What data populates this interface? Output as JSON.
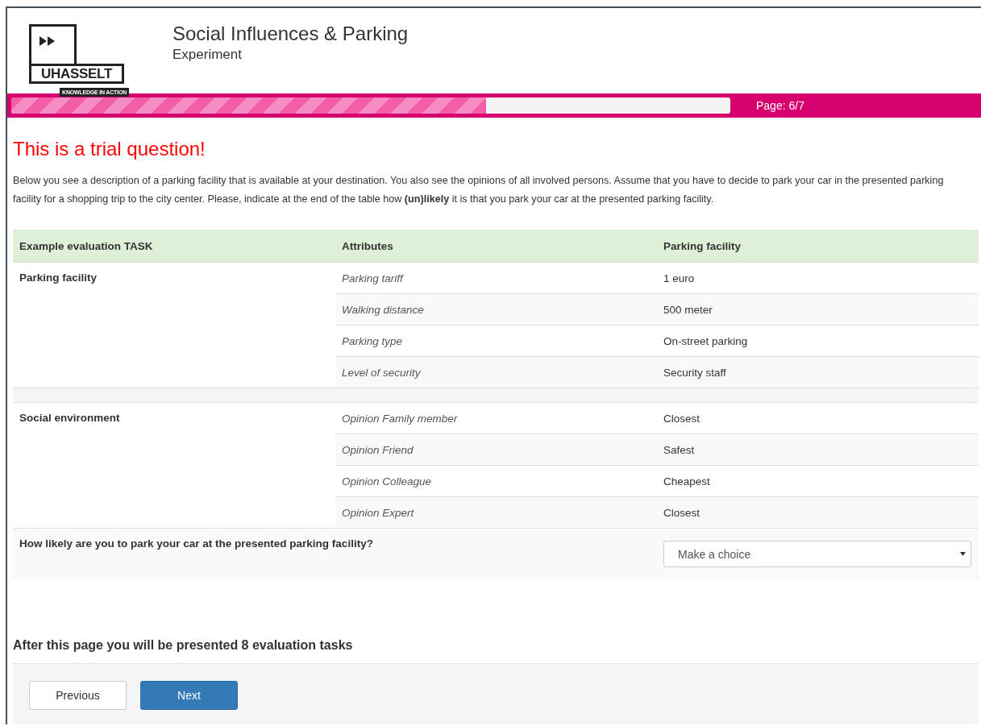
{
  "header": {
    "logo": {
      "name": "UHASSELT",
      "tagline": "KNOWLEDGE IN ACTION"
    },
    "title": "Social Influences & Parking",
    "subtitle": "Experiment"
  },
  "progress": {
    "level": 0.66,
    "label": "Page: 6/7"
  },
  "heading": "This is a trial question!",
  "intro": "Below you see a description of a parking facility that is available at your destination. You also see the opinions of all involved persons. Assume that you have to decide to park your car in the presented parking facility for a shopping trip to the city center. Please, indicate at the end of the table how **(un)likely** it is that you park your car at the presented parking facility.",
  "table": {
    "columns": [
      "Example evaluation TASK",
      "Attributes",
      "Parking facility"
    ],
    "groups": [
      {
        "label": "Parking facility",
        "rows": [
          {
            "attribute": "Parking tariff",
            "value": "1 euro"
          },
          {
            "attribute": "Walking distance",
            "value": "500 meter"
          },
          {
            "attribute": "Parking type",
            "value": "On-street parking"
          },
          {
            "attribute": "Level of security",
            "value": "Security staff"
          }
        ]
      },
      {
        "label": "Social environment",
        "rows": [
          {
            "attribute": "Opinion Family member",
            "value": "Closest"
          },
          {
            "attribute": "Opinion Friend",
            "value": "Safest"
          },
          {
            "attribute": "Opinion Colleague",
            "value": "Cheapest"
          },
          {
            "attribute": "Opinion Expert",
            "value": "Closest"
          }
        ]
      }
    ],
    "question": {
      "label": "How likely are you to park your car at the presented parking facility?",
      "select": {
        "placeholder": "Make a choice"
      }
    }
  },
  "note": "After this page you will be presented 8 evaluation tasks",
  "buttons": [
    {
      "label": "Previous",
      "kind": "default"
    },
    {
      "label": "Next",
      "kind": "primary"
    }
  ]
}
